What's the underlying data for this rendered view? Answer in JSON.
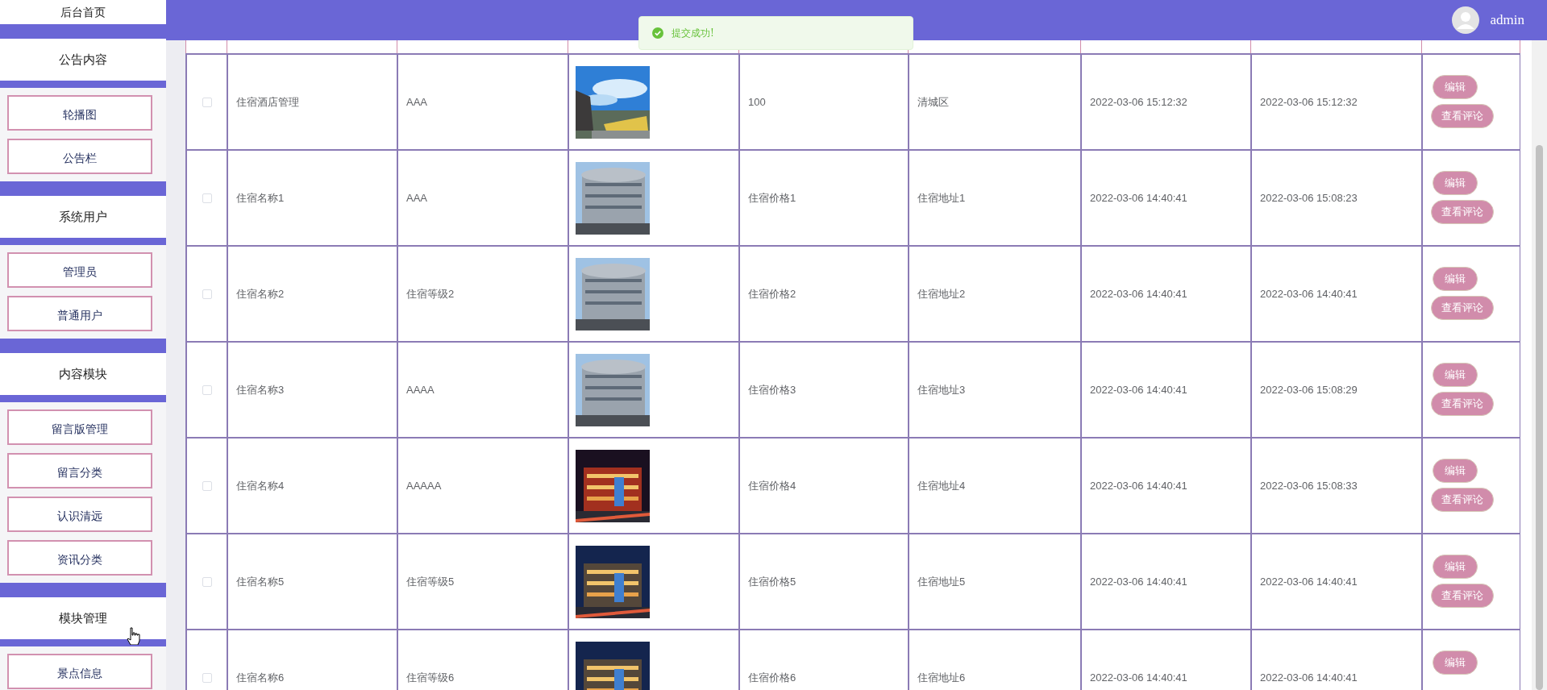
{
  "sidebar": {
    "top_item": "后台首页",
    "groups": [
      {
        "title": "公告内容",
        "items": [
          {
            "label": "轮播图"
          },
          {
            "label": "公告栏"
          }
        ]
      },
      {
        "title": "系统用户",
        "items": [
          {
            "label": "管理员"
          },
          {
            "label": "普通用户"
          }
        ]
      },
      {
        "title": "内容模块",
        "items": [
          {
            "label": "留言版管理"
          },
          {
            "label": "留言分类"
          },
          {
            "label": "认识清远"
          },
          {
            "label": "资讯分类"
          }
        ]
      },
      {
        "title": "模块管理",
        "items": [
          {
            "label": "景点信息"
          }
        ]
      }
    ]
  },
  "topbar": {
    "user": "admin"
  },
  "toast": {
    "kind": "success",
    "message": "提交成功!"
  },
  "table": {
    "rows": [
      {
        "checked": false,
        "name": "住宿酒店管理",
        "level": "AAA",
        "photo": {
          "kind": "picture"
        },
        "price": "100",
        "address": "清城区",
        "created": "2022-03-06 15:12:32",
        "updated": "2022-03-06 15:12:32",
        "actions": [
          "编辑",
          "查看评论"
        ]
      },
      {
        "checked": false,
        "name": "住宿名称1",
        "level": "AAA",
        "photo": {
          "kind": "picture"
        },
        "price": "住宿价格1",
        "address": "住宿地址1",
        "created": "2022-03-06 14:40:41",
        "updated": "2022-03-06 15:08:23",
        "actions": [
          "编辑",
          "查看评论"
        ]
      },
      {
        "checked": false,
        "name": "住宿名称2",
        "level": "住宿等级2",
        "photo": {
          "kind": "picture"
        },
        "price": "住宿价格2",
        "address": "住宿地址2",
        "created": "2022-03-06 14:40:41",
        "updated": "2022-03-06 14:40:41",
        "actions": [
          "编辑",
          "查看评论"
        ]
      },
      {
        "checked": false,
        "name": "住宿名称3",
        "level": "AAAA",
        "photo": {
          "kind": "picture"
        },
        "price": "住宿价格3",
        "address": "住宿地址3",
        "created": "2022-03-06 14:40:41",
        "updated": "2022-03-06 15:08:29",
        "actions": [
          "编辑",
          "查看评论"
        ]
      },
      {
        "checked": false,
        "name": "住宿名称4",
        "level": "AAAAA",
        "photo": {
          "kind": "picture"
        },
        "price": "住宿价格4",
        "address": "住宿地址4",
        "created": "2022-03-06 14:40:41",
        "updated": "2022-03-06 15:08:33",
        "actions": [
          "编辑",
          "查看评论"
        ]
      },
      {
        "checked": false,
        "name": "住宿名称5",
        "level": "住宿等级5",
        "photo": {
          "kind": "picture"
        },
        "price": "住宿价格5",
        "address": "住宿地址5",
        "created": "2022-03-06 14:40:41",
        "updated": "2022-03-06 14:40:41",
        "actions": [
          "编辑",
          "查看评论"
        ]
      },
      {
        "checked": false,
        "name": "住宿名称6",
        "level": "住宿等级6",
        "photo": {
          "kind": "picture"
        },
        "price": "住宿价格6",
        "address": "住宿地址6",
        "created": "2022-03-06 14:40:41",
        "updated": "2022-03-06 14:40:41",
        "actions": [
          "编辑"
        ]
      }
    ]
  }
}
